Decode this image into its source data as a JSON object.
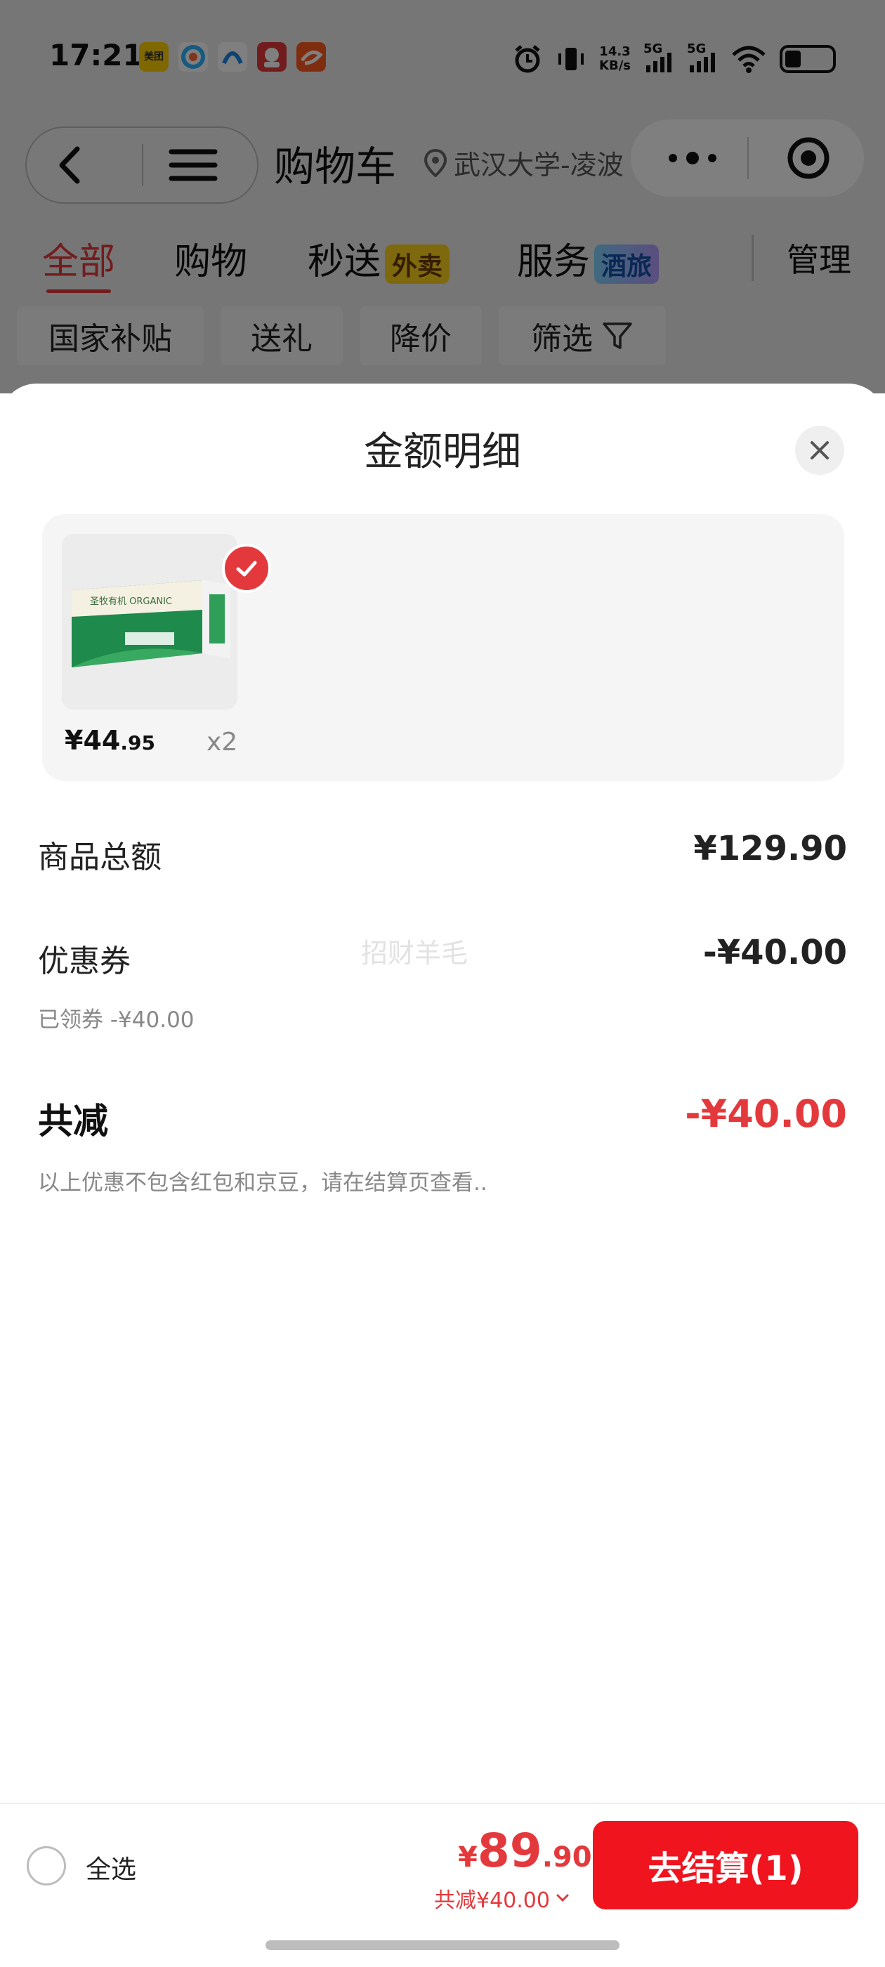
{
  "status_bar": {
    "time": "17:21",
    "apps": [
      {
        "icon": "meituan-icon",
        "text": "美团",
        "color": "#ffd100"
      },
      {
        "icon": "app-icon-2",
        "text": "",
        "color": "#ffffff"
      },
      {
        "icon": "app-icon-3",
        "text": "",
        "color": "#ffffff"
      },
      {
        "icon": "jd-icon",
        "text": "",
        "color": "#e4393c"
      },
      {
        "icon": "app-icon-5",
        "text": "",
        "color": "#ff5a1f"
      }
    ],
    "net_speed_value": "14.3",
    "net_speed_unit": "KB/s",
    "sig1_label": "5G",
    "sig2_label": "5G"
  },
  "nav": {
    "title": "购物车",
    "location": "武汉大学-凌波"
  },
  "tabs": [
    {
      "label": "全部"
    },
    {
      "label": "购物"
    },
    {
      "label": "秒送",
      "badge": "外卖"
    },
    {
      "label": "服务",
      "badge": "酒旅"
    }
  ],
  "manage": "管理",
  "chips": [
    "国家补贴",
    "送礼",
    "降价",
    "筛选"
  ],
  "sheet": {
    "title": "金额明细",
    "product": {
      "price_int": "¥44",
      "price_dec": ".95",
      "qty": "x2",
      "image_text": "圣牧有机 ORGANIC"
    },
    "rows": {
      "goods_total_label": "商品总额",
      "goods_total_value": "¥129.90",
      "coupon_label": "优惠券",
      "coupon_value": "-¥40.00",
      "coupon_note": "已领券 -¥40.00"
    },
    "total": {
      "label": "共减",
      "value": "-¥40.00",
      "note": "以上优惠不包含红包和京豆，请在结算页查看.."
    },
    "watermark": "招财羊毛"
  },
  "footer": {
    "select_all": "全选",
    "price_currency": "¥",
    "price_int": "89",
    "price_dec": ".90",
    "saved": "共减¥40.00",
    "checkout": "去结算(1)"
  }
}
